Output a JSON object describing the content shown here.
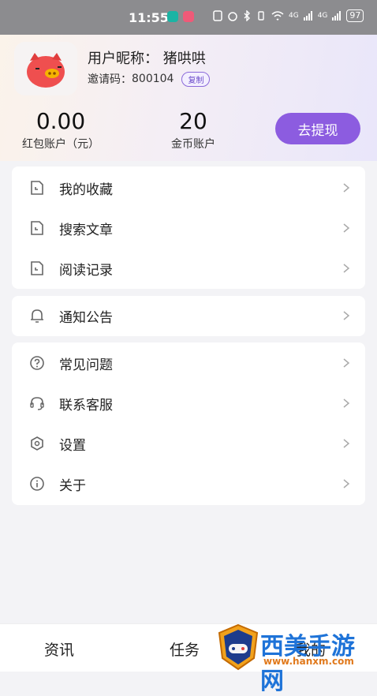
{
  "status_bar": {
    "time": "11:55",
    "battery": "97",
    "net1": "4G",
    "net2": "4G"
  },
  "profile": {
    "nickname": "用户昵称： 猪哄哄",
    "invite_label": "邀请码：",
    "invite_code": "800104",
    "copy_label": "复制"
  },
  "stats": {
    "red_packet_value": "0.00",
    "red_packet_label": "红包账户（元）",
    "coin_value": "20",
    "coin_label": "金币账户",
    "withdraw_label": "去提现"
  },
  "menu_group_1": [
    {
      "label": "我的收藏"
    },
    {
      "label": "搜索文章"
    },
    {
      "label": "阅读记录"
    }
  ],
  "menu_group_2": [
    {
      "label": "通知公告"
    }
  ],
  "menu_group_3": [
    {
      "label": "常见问题"
    },
    {
      "label": "联系客服"
    },
    {
      "label": "设置"
    },
    {
      "label": "关于"
    }
  ],
  "tabbar": {
    "tab1": "资讯",
    "tab2": "任务",
    "tab3": "我的"
  },
  "watermark": {
    "text": "西美手游网",
    "url": "www.hanxm.com"
  },
  "colors": {
    "accent": "#8c5ce0",
    "status_bar": "#8c8c8f"
  }
}
